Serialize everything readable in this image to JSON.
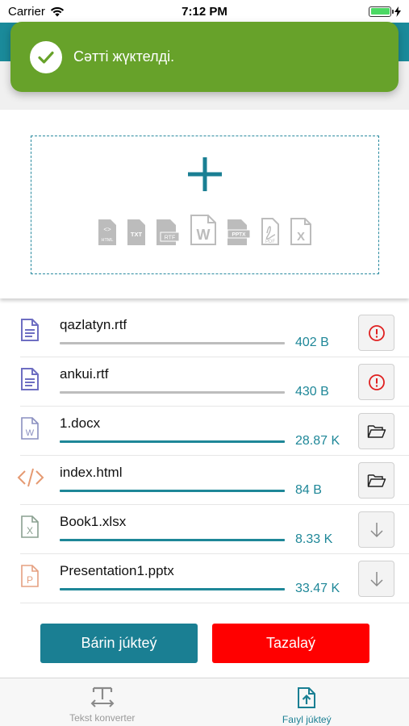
{
  "status_bar": {
    "carrier": "Carrier",
    "time": "7:12 PM"
  },
  "toast": {
    "message": "Сәтті жүктелді."
  },
  "upload": {
    "formats": [
      "HTML",
      "TXT",
      "RTF",
      "W",
      "PPTX",
      "PDF",
      "X"
    ]
  },
  "files": [
    {
      "name": "qazlatyn.rtf",
      "size": "402 B",
      "progress": 0,
      "icon": "text-file-icon",
      "action": "error-icon"
    },
    {
      "name": "ankui.rtf",
      "size": "430 B",
      "progress": 0,
      "icon": "text-file-icon",
      "action": "error-icon"
    },
    {
      "name": "1.docx",
      "size": "28.87 K",
      "progress": 100,
      "icon": "word-file-icon",
      "action": "open-folder-icon"
    },
    {
      "name": "index.html",
      "size": "84 B",
      "progress": 100,
      "icon": "code-file-icon",
      "action": "open-folder-icon"
    },
    {
      "name": "Book1.xlsx",
      "size": "8.33 K",
      "progress": 100,
      "icon": "excel-file-icon",
      "action": "download-icon"
    },
    {
      "name": "Presentation1.pptx",
      "size": "33.47 K",
      "progress": 100,
      "icon": "powerpoint-file-icon",
      "action": "download-icon"
    }
  ],
  "buttons": {
    "upload_all": "Bárin júkteý",
    "clear": "Tazalaý"
  },
  "tabs": [
    {
      "label": "Tekst konverter",
      "active": false
    },
    {
      "label": "Faıyl júkteý",
      "active": true
    }
  ],
  "colors": {
    "accent": "#1a7f93",
    "success": "#67a22a",
    "danger": "#ff0000",
    "error_icon": "#e02020"
  }
}
